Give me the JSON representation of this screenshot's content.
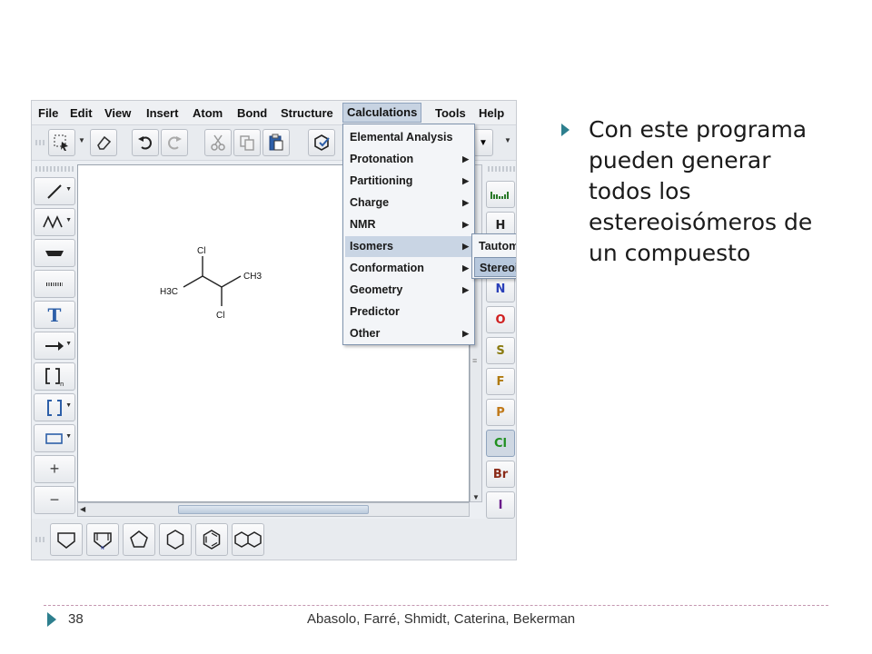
{
  "menubar": {
    "items": [
      "File",
      "Edit",
      "View",
      "Insert",
      "Atom",
      "Bond",
      "Structure",
      "Calculations",
      "Tools",
      "Help"
    ],
    "active": "Calculations"
  },
  "calculations_menu": {
    "items": [
      {
        "label": "Elemental Analysis",
        "submenu": false
      },
      {
        "label": "Protonation",
        "submenu": true
      },
      {
        "label": "Partitioning",
        "submenu": true
      },
      {
        "label": "Charge",
        "submenu": true
      },
      {
        "label": "NMR",
        "submenu": true
      },
      {
        "label": "Isomers",
        "submenu": true,
        "highlighted": true
      },
      {
        "label": "Conformation",
        "submenu": true
      },
      {
        "label": "Geometry",
        "submenu": true
      },
      {
        "label": "Predictor",
        "submenu": false
      },
      {
        "label": "Other",
        "submenu": true
      }
    ]
  },
  "isomers_submenu": {
    "items": [
      {
        "label": "Tautomers",
        "highlighted": false
      },
      {
        "label": "Stereoisomers",
        "highlighted": true
      }
    ]
  },
  "molecule": {
    "atoms": [
      "Cl",
      "CH3",
      "H3C",
      "Cl"
    ]
  },
  "element_buttons": [
    "H",
    "N",
    "O",
    "S",
    "F",
    "P",
    "Cl",
    "Br",
    "I"
  ],
  "element_colors": {
    "H": "#222222",
    "N": "#2a3fb8",
    "O": "#d02020",
    "S": "#8a7a10",
    "F": "#b07a10",
    "P": "#c07818",
    "Cl": "#1f8f1f",
    "Br": "#8a2a18",
    "I": "#6a1a8a"
  },
  "selected_element": "Cl",
  "left_tools": [
    "line-icon",
    "chain-icon",
    "bond-up-icon",
    "bond-hash-icon",
    "text-icon",
    "arrow-icon",
    "bracket-n-icon",
    "bracket-icon",
    "rectangle-icon",
    "plus-icon",
    "minus-icon"
  ],
  "bullet": {
    "text": "Con este programa pueden generar todos los estereoisómeros de un compuesto"
  },
  "footer": {
    "page_number": "38",
    "authors": "Abasolo, Farré, Shmidt, Caterina, Bekerman"
  },
  "accent_color": "#2d7f8e"
}
